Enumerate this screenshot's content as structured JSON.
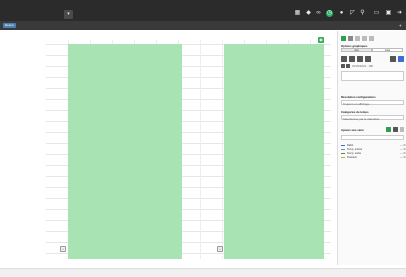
{
  "toolbar": {
    "dropdown_icon": "chevron-down-icon",
    "icons": [
      "grid-icon",
      "puzzle-icon",
      "link-icon",
      "clock-icon",
      "user-icon",
      "tag-icon",
      "pin-icon",
      "window-icon",
      "save-icon",
      "exit-icon"
    ],
    "active_color": "#27ae60"
  },
  "secondbar": {
    "app_tag": "Retour"
  },
  "chart": {
    "badge_icon": "eye-icon",
    "area_color": "#a8e3b3",
    "marker_icon": "lock-icon"
  },
  "panel": {
    "section1": "Options graphiques",
    "tab1": "Jour",
    "tab2": "Liste",
    "datetime_label": "01/09/2022 - 18h",
    "section2": "Résolution configurations",
    "section2_value": "Toujours en affichage",
    "section3": "Catégories de temps",
    "section3_value": "Sélectionner par le calendrier",
    "section4": "Ajouter une série",
    "legend": [
      {
        "label": "Débit",
        "color": "#3b6fd6",
        "value": "— %"
      },
      {
        "label": "Temp. entrée",
        "color": "#888888",
        "value": "— %"
      },
      {
        "label": "Temp. sortie",
        "color": "#2e9e4f",
        "value": "— %"
      },
      {
        "label": "Pression",
        "color": "#d6a73b",
        "value": "— %"
      }
    ]
  }
}
